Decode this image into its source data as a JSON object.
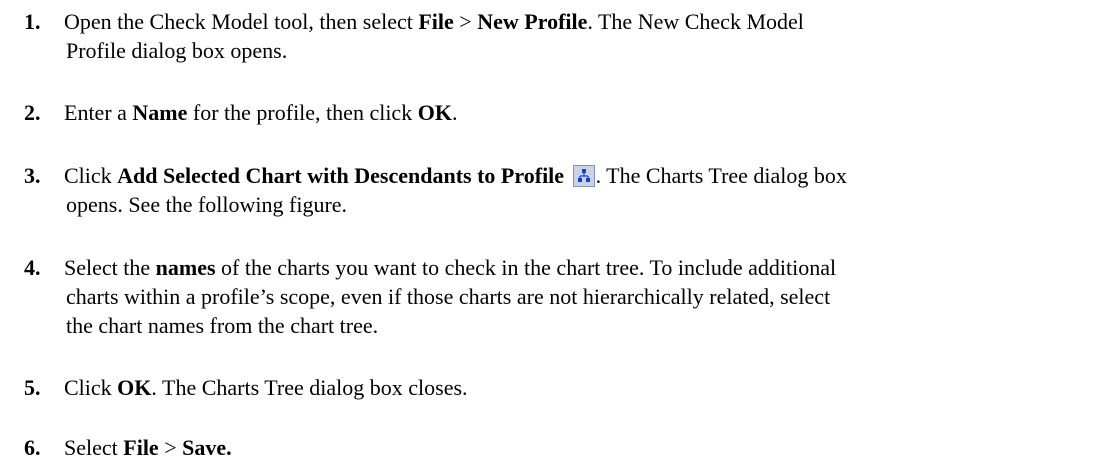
{
  "steps": [
    {
      "number": "1.",
      "line1": [
        {
          "t": "Open the Check Model tool, then select ",
          "b": false
        },
        {
          "t": "File",
          "b": true
        },
        {
          "t": " > ",
          "b": false
        },
        {
          "t": "New Profile",
          "b": true
        },
        {
          "t": ". The New Check Model",
          "b": false
        }
      ],
      "line2": [
        {
          "t": "Profile dialog box opens.",
          "b": false
        }
      ]
    },
    {
      "number": "2.",
      "line1": [
        {
          "t": "Enter a ",
          "b": false
        },
        {
          "t": "Name",
          "b": true
        },
        {
          "t": " for the profile, then click ",
          "b": false
        },
        {
          "t": "OK",
          "b": true
        },
        {
          "t": ".",
          "b": false
        }
      ]
    },
    {
      "number": "3.",
      "line1": [
        {
          "t": "Click ",
          "b": false
        },
        {
          "t": "Add Selected Chart with Descendants to Profile",
          "b": true
        },
        {
          "t": " ",
          "b": false
        },
        {
          "icon": "chart-tree-icon"
        },
        {
          "t": ". The Charts Tree dialog box",
          "b": false
        }
      ],
      "line2": [
        {
          "t": "opens. See the following figure.",
          "b": false
        }
      ]
    },
    {
      "number": "4.",
      "line1": [
        {
          "t": "Select the ",
          "b": false
        },
        {
          "t": "names",
          "b": true
        },
        {
          "t": " of the charts you want to check in the chart tree. To include additional",
          "b": false
        }
      ],
      "line2": [
        {
          "t": "charts within a profile’s scope, even if those charts are not hierarchically related, select",
          "b": false
        }
      ],
      "line3": [
        {
          "t": "the chart names from the chart tree.",
          "b": false
        }
      ]
    },
    {
      "number": "5.",
      "line1": [
        {
          "t": "Click ",
          "b": false
        },
        {
          "t": "OK",
          "b": true
        },
        {
          "t": ". The Charts Tree dialog box closes.",
          "b": false
        }
      ]
    },
    {
      "number": "6.",
      "line1": [
        {
          "t": "Select ",
          "b": false
        },
        {
          "t": "File",
          "b": true
        },
        {
          "t": " > ",
          "b": false
        },
        {
          "t": "Save.",
          "b": true
        }
      ]
    }
  ]
}
